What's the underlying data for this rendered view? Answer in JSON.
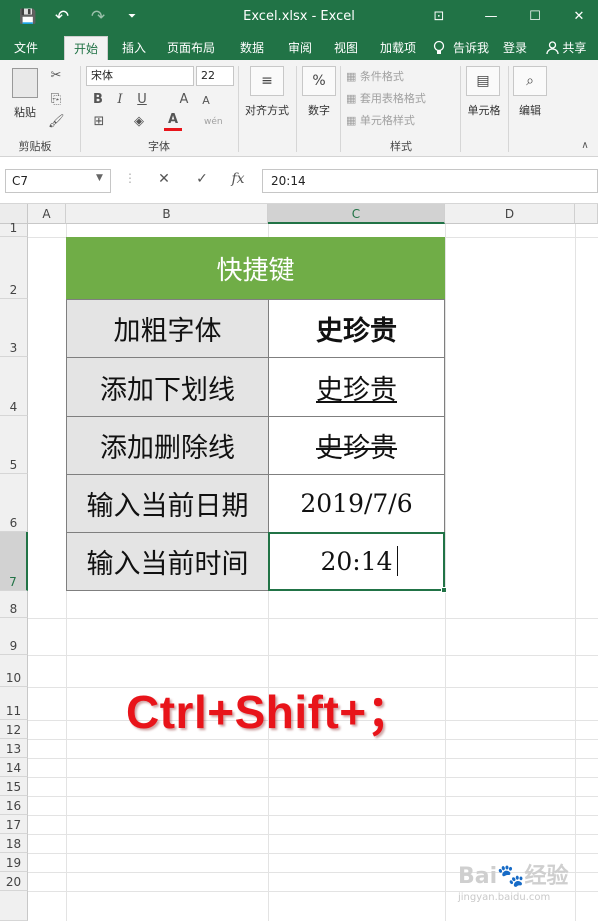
{
  "window": {
    "title": "Excel.xlsx - Excel",
    "qat": {
      "save": "💾",
      "undo": "↶",
      "redo": "↷",
      "customize": "⏷"
    },
    "controls": {
      "ribbon_display": "⊡",
      "minimize": "—",
      "maximize": "☐",
      "close": "✕"
    }
  },
  "tabs": [
    {
      "label": "文件"
    },
    {
      "label": "开始"
    },
    {
      "label": "插入"
    },
    {
      "label": "页面布局"
    },
    {
      "label": "数据"
    },
    {
      "label": "审阅"
    },
    {
      "label": "视图"
    },
    {
      "label": "加载项"
    }
  ],
  "tell_me": "告诉我",
  "sign_in": "登录",
  "share": "共享",
  "ribbon": {
    "clipboard": {
      "label": "剪贴板",
      "paste": "粘贴"
    },
    "font": {
      "label": "字体",
      "font_name": "宋体",
      "font_size": "22",
      "bold": "B",
      "italic": "I",
      "underline": "U",
      "grow": "A",
      "shrink": "A",
      "color": "A",
      "phonetic": "wén"
    },
    "alignment": {
      "label": "对齐方式"
    },
    "number": {
      "label": "数字",
      "icon": "%"
    },
    "styles": {
      "label": "样式",
      "conditional": "条件格式",
      "table": "套用表格格式",
      "cell_styles": "单元格样式"
    },
    "cells": {
      "label": "单元格"
    },
    "editing": {
      "label": "编辑"
    }
  },
  "formula_bar": {
    "name_box": "C7",
    "cancel": "✕",
    "enter": "✓",
    "fx": "fx",
    "content": "20:14"
  },
  "columns": [
    "A",
    "B",
    "C",
    "D"
  ],
  "rows": [
    "1",
    "2",
    "3",
    "4",
    "5",
    "6",
    "7",
    "8",
    "9",
    "10",
    "11",
    "12",
    "13",
    "14",
    "15",
    "16",
    "17",
    "18",
    "19",
    "20"
  ],
  "table": {
    "header": "快捷键",
    "rows": [
      {
        "label": "加粗字体",
        "value": "史珍贵"
      },
      {
        "label": "添加下划线",
        "value": "史珍贵"
      },
      {
        "label": "添加删除线",
        "value": "史珍贵"
      },
      {
        "label": "输入当前日期",
        "value": "2019/7/6"
      },
      {
        "label": "输入当前时间",
        "value": "20:14"
      }
    ]
  },
  "shortcut_text": "Ctrl+Shift+；",
  "watermark": {
    "line1": "Bai🐾经验",
    "line2": "jingyan.baidu.com"
  }
}
